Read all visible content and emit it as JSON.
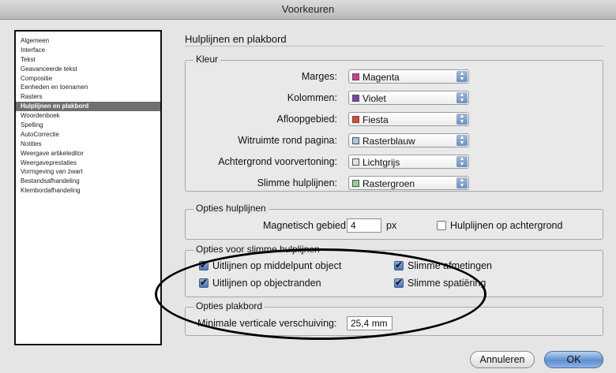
{
  "window": {
    "title": "Voorkeuren"
  },
  "sidebar": {
    "items": [
      {
        "label": "Algemeen"
      },
      {
        "label": "Interface"
      },
      {
        "label": "Tekst"
      },
      {
        "label": "Geavanceerde tekst"
      },
      {
        "label": "Compositie"
      },
      {
        "label": "Eenheden en toenamen"
      },
      {
        "label": "Rasters"
      },
      {
        "label": "Hulplijnen en plakbord",
        "selected": true
      },
      {
        "label": "Woordenboek"
      },
      {
        "label": "Spelling"
      },
      {
        "label": "AutoCorrectie"
      },
      {
        "label": "Notities"
      },
      {
        "label": "Weergave artikeleditor"
      },
      {
        "label": "Weergaveprestaties"
      },
      {
        "label": "Vormgeving van zwart"
      },
      {
        "label": "Bestandsafhandeling"
      },
      {
        "label": "Klembordafhandeling"
      }
    ]
  },
  "main": {
    "title": "Hulplijnen en plakbord",
    "kleur": {
      "legend": "Kleur",
      "rows": [
        {
          "label": "Marges:",
          "value": "Magenta",
          "swatch": "#d23a9a"
        },
        {
          "label": "Kolommen:",
          "value": "Violet",
          "swatch": "#7a3fb0"
        },
        {
          "label": "Afloopgebied:",
          "value": "Fiesta",
          "swatch": "#e8452e"
        },
        {
          "label": "Witruimte rond pagina:",
          "value": "Rasterblauw",
          "swatch": "#a8c4e6"
        },
        {
          "label": "Achtergrond voorvertoning:",
          "value": "Lichtgrijs",
          "swatch": "#e2e2e2"
        },
        {
          "label": "Slimme hulplijnen:",
          "value": "Rastergroen",
          "swatch": "#8fd08f"
        }
      ]
    },
    "opties_hulplijnen": {
      "legend": "Opties hulplijnen",
      "magnetisch_label": "Magnetisch gebied:",
      "magnetisch_value": "4",
      "unit": "px",
      "achtergrond_label": "Hulplijnen op achtergrond",
      "achtergrond_checked": false
    },
    "slimme_hulplijnen": {
      "legend": "Opties voor slimme hulplijnen",
      "options": [
        {
          "label": "Uitlijnen op middelpunt object",
          "checked": true
        },
        {
          "label": "Slimme afmetingen",
          "checked": true
        },
        {
          "label": "Uitlijnen op objectranden",
          "checked": true
        },
        {
          "label": "Slimme spatiëring",
          "checked": true
        }
      ]
    },
    "plakbord": {
      "legend": "Opties plakbord",
      "label": "Minimale verticale verschuiving:",
      "value": "25,4 mm"
    }
  },
  "buttons": {
    "cancel": "Annuleren",
    "ok": "OK"
  }
}
